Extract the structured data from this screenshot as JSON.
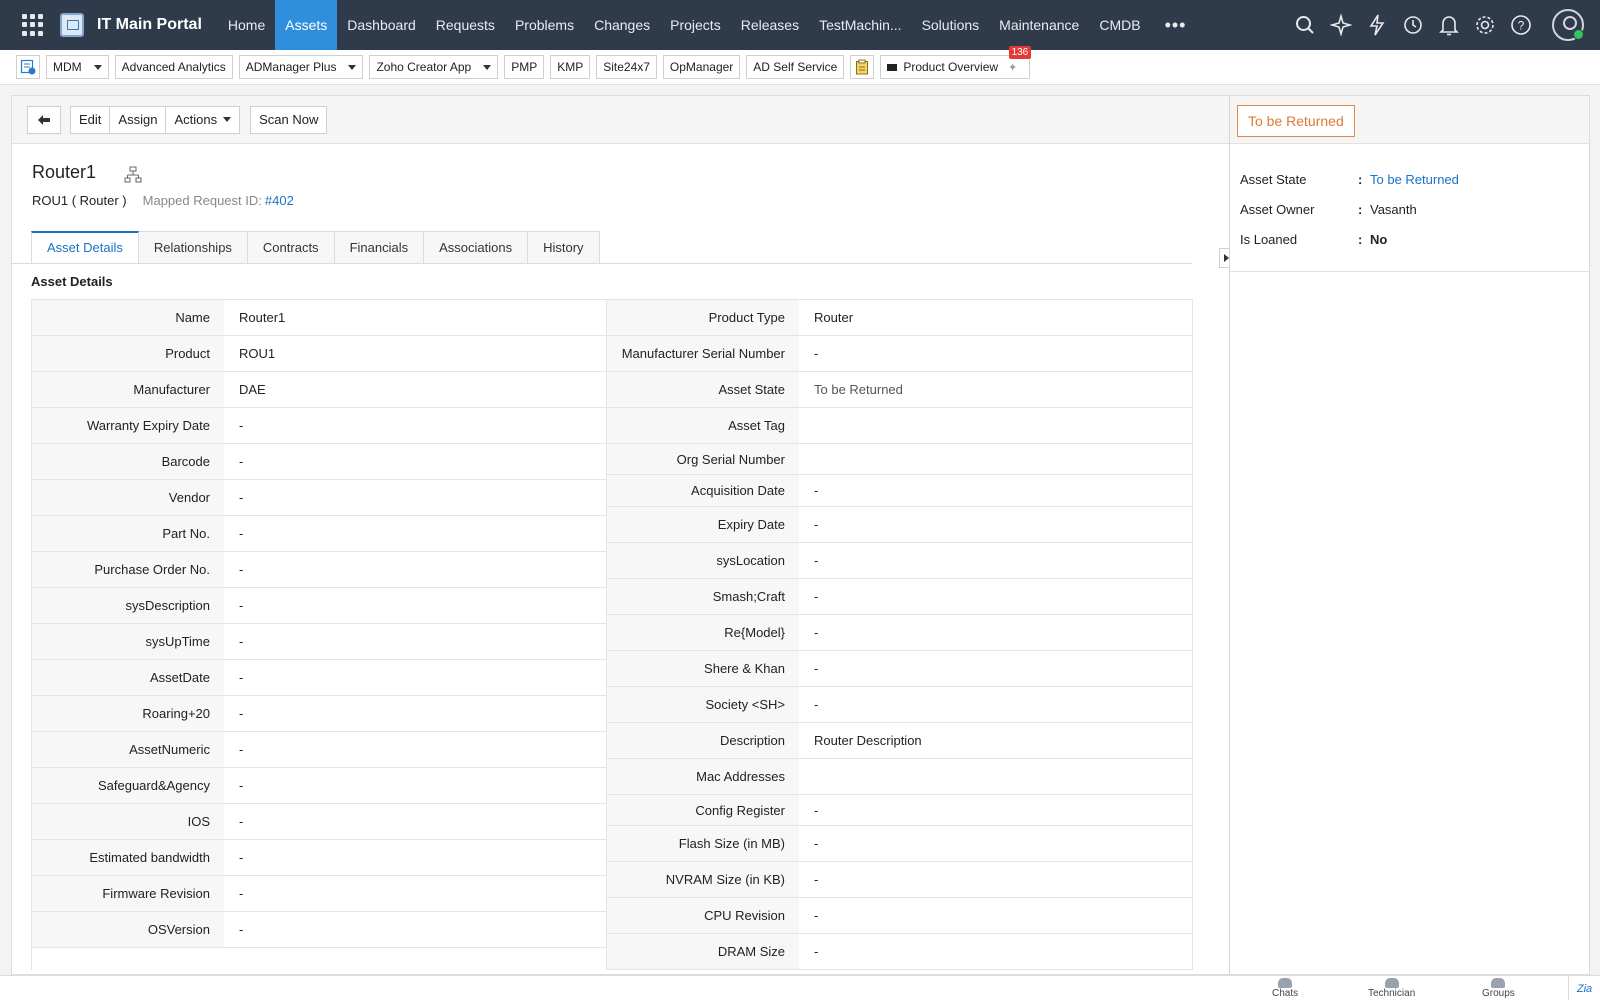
{
  "header": {
    "app_title": "IT Main Portal",
    "nav": [
      "Home",
      "Assets",
      "Dashboard",
      "Requests",
      "Problems",
      "Changes",
      "Projects",
      "Releases",
      "TestMachin...",
      "Solutions",
      "Maintenance",
      "CMDB"
    ],
    "active_nav": "Assets",
    "more_label": "•••",
    "icons": [
      "search-icon",
      "sparkle-icon",
      "lightning-icon",
      "history-icon",
      "bell-icon",
      "gear-icon",
      "help-icon",
      "user-avatar"
    ]
  },
  "quickbar": {
    "items": [
      "MDM",
      "Advanced Analytics",
      "ADManager Plus",
      "Zoho Creator App",
      "PMP",
      "KMP",
      "Site24x7",
      "OpManager",
      "AD Self Service"
    ],
    "product_overview": "Product Overview",
    "badge_count": "136"
  },
  "toolbar": {
    "edit": "Edit",
    "assign": "Assign",
    "actions": "Actions",
    "scan_now": "Scan Now"
  },
  "asset": {
    "name": "Router1",
    "product_label": "ROU1 ( Router )",
    "mapped_label": "Mapped Request ID:",
    "mapped_id": "#402"
  },
  "tabs": [
    "Asset Details",
    "Relationships",
    "Contracts",
    "Financials",
    "Associations",
    "History"
  ],
  "section_title": "Asset Details",
  "details_left": [
    {
      "label": "Name",
      "value": "Router1"
    },
    {
      "label": "Product",
      "value": "ROU1"
    },
    {
      "label": "Manufacturer",
      "value": "DAE"
    },
    {
      "label": "Warranty Expiry Date",
      "value": "-"
    },
    {
      "label": "Barcode",
      "value": "-"
    },
    {
      "label": "Vendor",
      "value": "-"
    },
    {
      "label": "Part No.",
      "value": "-"
    },
    {
      "label": "Purchase Order No.",
      "value": "-"
    },
    {
      "label": "sysDescription",
      "value": "-"
    },
    {
      "label": "sysUpTime",
      "value": "-"
    },
    {
      "label": "AssetDate",
      "value": "-"
    },
    {
      "label": "Roaring+20",
      "value": "-"
    },
    {
      "label": "AssetNumeric",
      "value": "-"
    },
    {
      "label": "Safeguard&Agency",
      "value": "-"
    },
    {
      "label": "IOS",
      "value": "-"
    },
    {
      "label": "Estimated bandwidth",
      "value": "-"
    },
    {
      "label": "Firmware Revision",
      "value": "-"
    },
    {
      "label": "OSVersion",
      "value": "-"
    }
  ],
  "details_right": [
    {
      "label": "Product Type",
      "value": "Router"
    },
    {
      "label": "Manufacturer Serial Number",
      "value": "-"
    },
    {
      "label": "Asset State",
      "value": "To be Returned"
    },
    {
      "label": "Asset Tag",
      "value": ""
    },
    {
      "label": "Org Serial Number",
      "value": ""
    },
    {
      "label": "Acquisition Date",
      "value": "-"
    },
    {
      "label": "Expiry Date",
      "value": "-"
    },
    {
      "label": "sysLocation",
      "value": "-"
    },
    {
      "label": "Smash;Craft",
      "value": "-"
    },
    {
      "label": "Re{Model}",
      "value": "-"
    },
    {
      "label": "Shere & Khan",
      "value": "-"
    },
    {
      "label": "Society <SH>",
      "value": "-"
    },
    {
      "label": "Description",
      "value": "Router Description"
    },
    {
      "label": "Mac Addresses",
      "value": ""
    },
    {
      "label": "Config Register",
      "value": "-"
    },
    {
      "label": "Flash Size (in MB)",
      "value": "-"
    },
    {
      "label": "NVRAM Size (in KB)",
      "value": "-"
    },
    {
      "label": "CPU Revision",
      "value": "-"
    },
    {
      "label": "DRAM Size",
      "value": "-"
    }
  ],
  "side": {
    "state_button": "To be Returned",
    "rows": [
      {
        "key": "Asset State",
        "value": "To be Returned"
      },
      {
        "key": "Asset Owner",
        "value": "Vasanth"
      },
      {
        "key": "Is Loaned",
        "value": "No"
      }
    ],
    "colon": ":"
  },
  "bottombar": {
    "chats": "Chats",
    "technician": "Technician",
    "groups": "Groups"
  },
  "colors": {
    "nav_bg": "#2f3a4a",
    "accent": "#2f8fdd",
    "link": "#1a73c9",
    "state_orange": "#e07a35"
  }
}
